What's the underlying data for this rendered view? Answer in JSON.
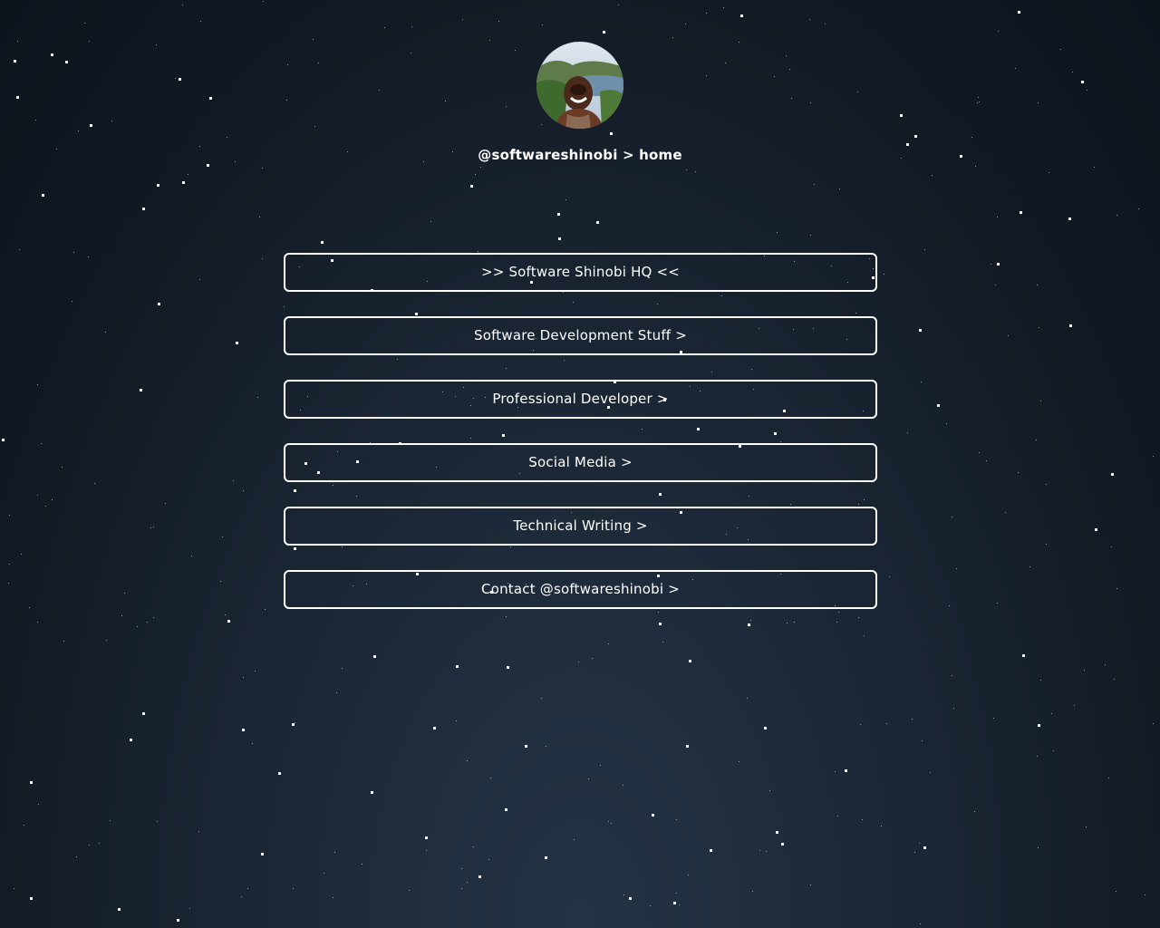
{
  "colors": {
    "background_center": "#243445",
    "background_edge": "#0e141c",
    "button_border": "#ffffff",
    "text": "#ffffff"
  },
  "profile": {
    "avatar_alt": "profile photo",
    "handle": "@softwareshinobi > home"
  },
  "links": [
    {
      "label": ">> Software Shinobi HQ <<"
    },
    {
      "label": "Software Development Stuff >"
    },
    {
      "label": "Professional Developer >"
    },
    {
      "label": "Social Media >"
    },
    {
      "label": "Technical Writing >"
    },
    {
      "label": "Contact @softwareshinobi >"
    }
  ]
}
